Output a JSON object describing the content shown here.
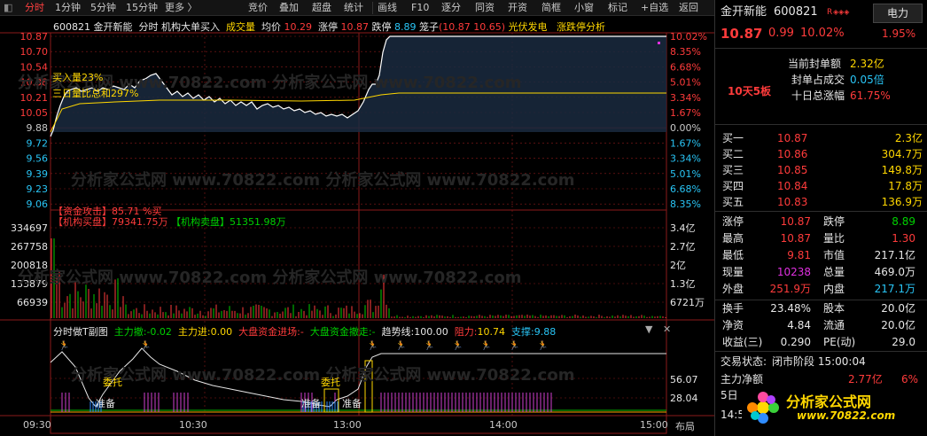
{
  "toolbar": {
    "left_items": [
      "分时",
      "1分钟",
      "5分钟",
      "15分钟",
      "更多 〉"
    ],
    "right_items": [
      "竞价",
      "叠加",
      "超盘",
      "统计",
      "画线",
      "F10",
      "逐分",
      "同资",
      "开资",
      "简框",
      "小窗",
      "标记",
      "+自选",
      "返回"
    ]
  },
  "title_bar": {
    "code": "600821",
    "name": "金开新能",
    "mode": "分时",
    "indicator": "机构大单买入",
    "volume_label": "成交量",
    "avg_label": "均价",
    "avg_value": "10.29",
    "limit_up_label": "涨停",
    "limit_up_value": "10.87",
    "limit_down_label": "跌停",
    "limit_down_value": "8.89",
    "cage_label": "笼子",
    "cage_value": "(10.87 10.65)",
    "concept": "光伏发电",
    "analysis": "涨跌停分析"
  },
  "price_axis_left": [
    "10.87",
    "10.70",
    "10.54",
    "10.38",
    "10.21",
    "10.05",
    "9.88",
    "9.72",
    "9.56",
    "9.39",
    "9.23",
    "9.06"
  ],
  "pct_axis_right": [
    "10.02%",
    "8.35%",
    "6.68%",
    "5.01%",
    "3.34%",
    "1.67%",
    "0.00%",
    "1.67%",
    "3.34%",
    "5.01%",
    "6.68%",
    "8.35%"
  ],
  "main_annotations": {
    "buy_ratio": "买入量23%",
    "three_day": "三日量比总和297%",
    "fund_attack": "【资金攻击】85.71 %买",
    "inst_buy": "【机构买盘】79341.75万",
    "inst_sell": "【机构卖盘】51351.98万"
  },
  "volume_axis_left": [
    "334697",
    "267758",
    "200818",
    "133879",
    "66939"
  ],
  "volume_axis_right": [
    "3.4亿",
    "2.7亿",
    "2亿",
    "1.3亿",
    "6721万"
  ],
  "sub_title": {
    "name": "分时做T副图",
    "main_withdraw_label": "主力撤:",
    "main_withdraw_value": "-0.02",
    "main_in_label": "主力进:",
    "main_in_value": "0.00",
    "market_in_label": "大盘资金进场:",
    "market_in_value": "-",
    "market_out_label": "大盘资金撤走:",
    "market_out_value": "-",
    "trend_label": "趋势线:",
    "trend_value": "100.00",
    "resist_label": "阻力:",
    "resist_value": "10.74",
    "support_label": "支撑:",
    "support_value": "9.88"
  },
  "sub_axis_right": [
    "56.07",
    "28.04"
  ],
  "sub_labels": {
    "a": "委托",
    "b": "准备",
    "c": "准备",
    "d": "委托",
    "e": "准备"
  },
  "time_axis": [
    "09:30",
    "10:30",
    "13:00",
    "14:00",
    "15:00"
  ],
  "layout_btn": "布局",
  "watermark": "分析家公式网 www.70822.com",
  "panel": {
    "name": "金开新能",
    "code": "600821",
    "flag": "R",
    "sector": "电力",
    "sector_pct": "1.95%",
    "price": "10.87",
    "change": "0.99",
    "change_pct": "10.02%",
    "streak": "10天5板",
    "seal_amount_label": "当前封单额",
    "seal_amount": "2.32亿",
    "seal_ratio_label": "封单占成交",
    "seal_ratio": "0.05倍",
    "ten_day_label": "十日总涨幅",
    "ten_day": "61.75%",
    "bids": [
      {
        "label": "买一",
        "price": "10.87",
        "vol": "2.3亿"
      },
      {
        "label": "买二",
        "price": "10.86",
        "vol": "304.7万"
      },
      {
        "label": "买三",
        "price": "10.85",
        "vol": "149.8万"
      },
      {
        "label": "买四",
        "price": "10.84",
        "vol": "17.8万"
      },
      {
        "label": "买五",
        "price": "10.83",
        "vol": "136.9万"
      }
    ],
    "stats": [
      {
        "l1": "涨停",
        "v1": "10.87",
        "c1": "red",
        "l2": "跌停",
        "v2": "8.89",
        "c2": "green"
      },
      {
        "l1": "最高",
        "v1": "10.87",
        "c1": "red",
        "l2": "量比",
        "v2": "1.30",
        "c2": "red"
      },
      {
        "l1": "最低",
        "v1": "9.81",
        "c1": "red",
        "l2": "市值",
        "v2": "217.1亿",
        "c2": "white"
      },
      {
        "l1": "现量",
        "v1": "10238",
        "c1": "magenta",
        "l2": "总量",
        "v2": "469.0万",
        "c2": "white"
      },
      {
        "l1": "外盘",
        "v1": "251.9万",
        "c1": "red",
        "l2": "内盘",
        "v2": "217.1万",
        "c2": "cyan"
      }
    ],
    "stats2": [
      {
        "l1": "换手",
        "v1": "23.48%",
        "l2": "股本",
        "v2": "20.0亿"
      },
      {
        "l1": "净资",
        "v1": "4.84",
        "l2": "流通",
        "v2": "20.0亿"
      },
      {
        "l1": "收益(三)",
        "v1": "0.290",
        "l2": "PE(动)",
        "v2": "29.0"
      }
    ],
    "trade_status_label": "交易状态:",
    "trade_status": "闭市阶段 15:00:04",
    "net_main_label": "主力净额",
    "net_main_value": "2.77亿",
    "net_main_pct": "6%",
    "five_day": "5日",
    "partial": "14:5",
    "logo_text": "分析家公式网",
    "logo_url": "www.70822.com"
  },
  "colors": {
    "up": "#ff3b3b",
    "down": "#00d000",
    "price_line": "#ffffff",
    "avg_line": "#ffd700",
    "grid": "#8b1a1a",
    "toolbar_sel": "#ff4040"
  }
}
